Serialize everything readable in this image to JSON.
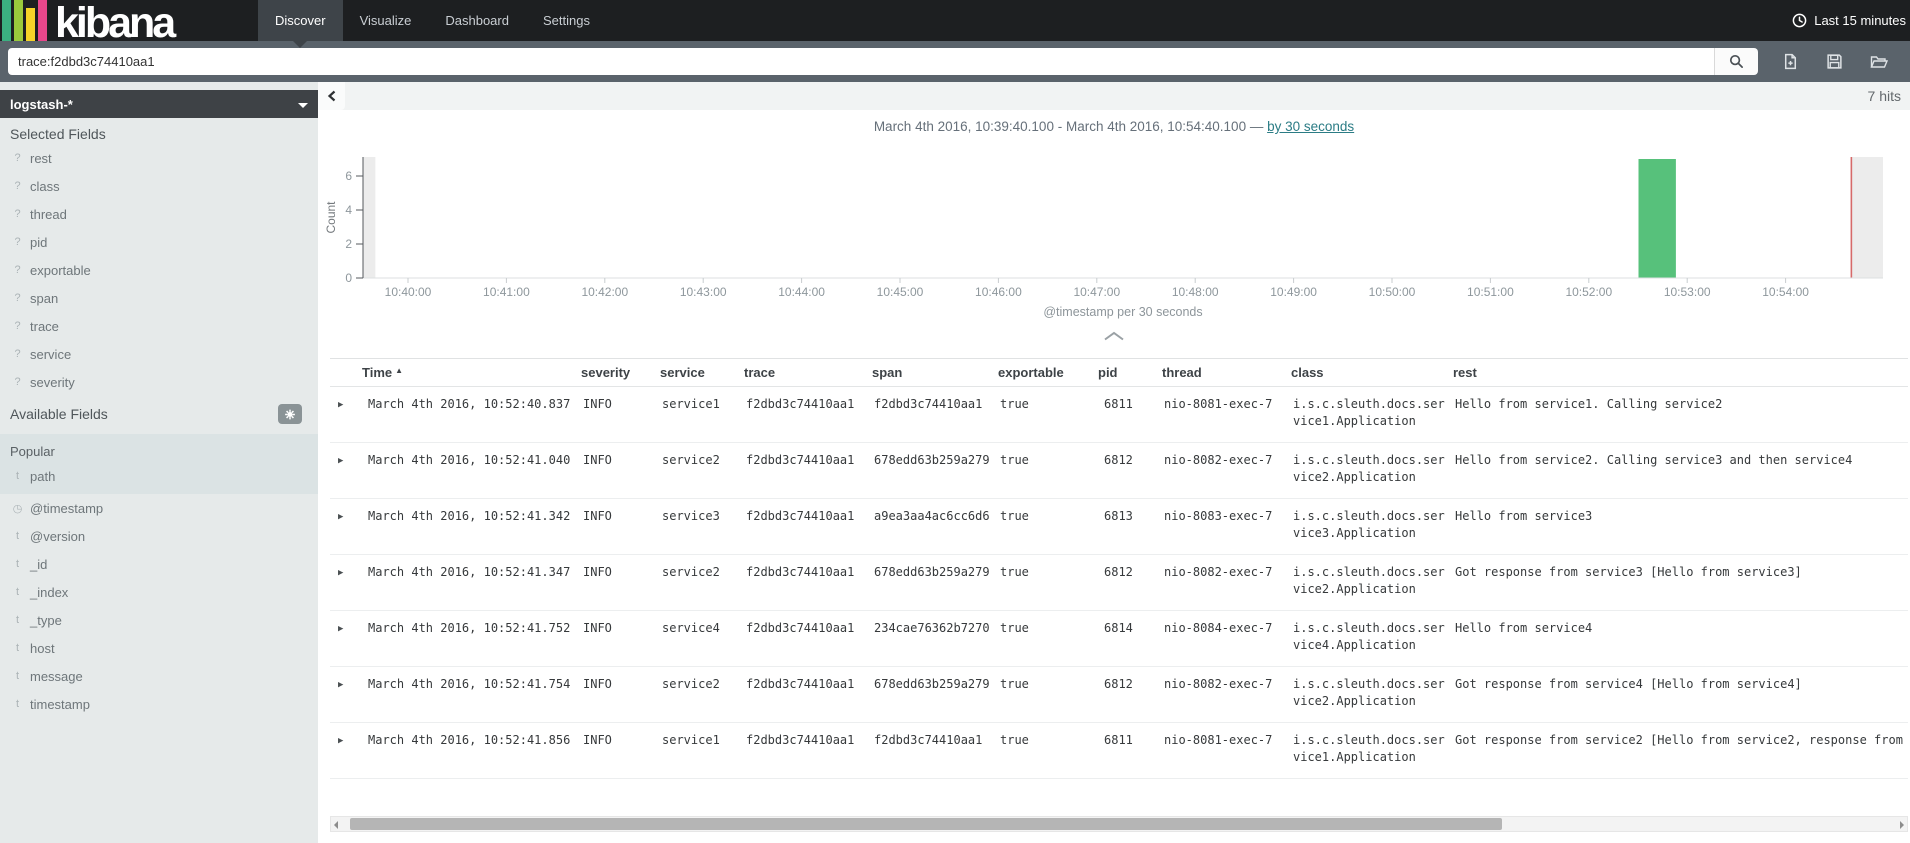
{
  "navbar": {
    "brand": "kibana",
    "nav_items": [
      {
        "label": "Discover",
        "active": true
      },
      {
        "label": "Visualize",
        "active": false
      },
      {
        "label": "Dashboard",
        "active": false
      },
      {
        "label": "Settings",
        "active": false
      }
    ],
    "time_filter": "Last 15 minutes"
  },
  "query_bar": {
    "query": "trace:f2dbd3c74410aa1"
  },
  "sidebar": {
    "index_pattern": "logstash-*",
    "selected_fields_title": "Selected Fields",
    "selected_fields": [
      {
        "type": "?",
        "name": "rest"
      },
      {
        "type": "?",
        "name": "class"
      },
      {
        "type": "?",
        "name": "thread"
      },
      {
        "type": "?",
        "name": "pid"
      },
      {
        "type": "?",
        "name": "exportable"
      },
      {
        "type": "?",
        "name": "span"
      },
      {
        "type": "?",
        "name": "trace"
      },
      {
        "type": "?",
        "name": "service"
      },
      {
        "type": "?",
        "name": "severity"
      }
    ],
    "available_fields_title": "Available Fields",
    "popular_title": "Popular",
    "popular_fields": [
      {
        "type": "t",
        "name": "path"
      }
    ],
    "available_fields": [
      {
        "type": "clock",
        "name": "@timestamp"
      },
      {
        "type": "t",
        "name": "@version"
      },
      {
        "type": "t",
        "name": "_id"
      },
      {
        "type": "t",
        "name": "_index"
      },
      {
        "type": "t",
        "name": "_type"
      },
      {
        "type": "t",
        "name": "host"
      },
      {
        "type": "t",
        "name": "message"
      },
      {
        "type": "t",
        "name": "timestamp"
      }
    ]
  },
  "results_header": {
    "hits": "7 hits",
    "time_range": "March 4th 2016, 10:39:40.100 - March 4th 2016, 10:54:40.100 —",
    "interval_link": "by 30 seconds"
  },
  "chart_data": {
    "type": "bar",
    "title": "",
    "xlabel": "@timestamp per 30 seconds",
    "ylabel": "Count",
    "y_ticks": [
      0,
      2,
      4,
      6
    ],
    "ylim": [
      0,
      7
    ],
    "x_tick_labels": [
      "10:40:00",
      "10:41:00",
      "10:42:00",
      "10:43:00",
      "10:44:00",
      "10:45:00",
      "10:46:00",
      "10:47:00",
      "10:48:00",
      "10:49:00",
      "10:50:00",
      "10:51:00",
      "10:52:00",
      "10:53:00",
      "10:54:00"
    ],
    "x_range": [
      "10:39:40.100",
      "10:54:40.100"
    ],
    "bucket_seconds": 30,
    "bars": [
      {
        "x_start": "10:52:30",
        "value": 7
      }
    ],
    "colors": {
      "bar": "#57c17b",
      "time_marker": "#d66a6a",
      "out_of_range_band": "#ececec",
      "link": "#2b7c85"
    }
  },
  "table": {
    "columns": [
      "Time",
      "severity",
      "service",
      "trace",
      "span",
      "exportable",
      "pid",
      "thread",
      "class",
      "rest"
    ],
    "sort": {
      "column": "Time",
      "direction": "asc"
    },
    "rows": [
      {
        "time": "March 4th 2016, 10:52:40.837",
        "severity": "INFO",
        "service": "service1",
        "trace": "f2dbd3c74410aa1",
        "span": "f2dbd3c74410aa1",
        "exportable": "true",
        "pid": "6811",
        "thread": "nio-8081-exec-7",
        "class": "i.s.c.sleuth.docs.service1.Application",
        "rest": "Hello from service1. Calling service2"
      },
      {
        "time": "March 4th 2016, 10:52:41.040",
        "severity": "INFO",
        "service": "service2",
        "trace": "f2dbd3c74410aa1",
        "span": "678edd63b259a279",
        "exportable": "true",
        "pid": "6812",
        "thread": "nio-8082-exec-7",
        "class": "i.s.c.sleuth.docs.service2.Application",
        "rest": "Hello from service2. Calling service3 and then service4"
      },
      {
        "time": "March 4th 2016, 10:52:41.342",
        "severity": "INFO",
        "service": "service3",
        "trace": "f2dbd3c74410aa1",
        "span": "a9ea3aa4ac6cc6d6",
        "exportable": "true",
        "pid": "6813",
        "thread": "nio-8083-exec-7",
        "class": "i.s.c.sleuth.docs.service3.Application",
        "rest": "Hello from service3"
      },
      {
        "time": "March 4th 2016, 10:52:41.347",
        "severity": "INFO",
        "service": "service2",
        "trace": "f2dbd3c74410aa1",
        "span": "678edd63b259a279",
        "exportable": "true",
        "pid": "6812",
        "thread": "nio-8082-exec-7",
        "class": "i.s.c.sleuth.docs.service2.Application",
        "rest": "Got response from service3 [Hello from service3]"
      },
      {
        "time": "March 4th 2016, 10:52:41.752",
        "severity": "INFO",
        "service": "service4",
        "trace": "f2dbd3c74410aa1",
        "span": "234cae76362b7270",
        "exportable": "true",
        "pid": "6814",
        "thread": "nio-8084-exec-7",
        "class": "i.s.c.sleuth.docs.service4.Application",
        "rest": "Hello from service4"
      },
      {
        "time": "March 4th 2016, 10:52:41.754",
        "severity": "INFO",
        "service": "service2",
        "trace": "f2dbd3c74410aa1",
        "span": "678edd63b259a279",
        "exportable": "true",
        "pid": "6812",
        "thread": "nio-8082-exec-7",
        "class": "i.s.c.sleuth.docs.service2.Application",
        "rest": "Got response from service4 [Hello from service4]"
      },
      {
        "time": "March 4th 2016, 10:52:41.856",
        "severity": "INFO",
        "service": "service1",
        "trace": "f2dbd3c74410aa1",
        "span": "f2dbd3c74410aa1",
        "exportable": "true",
        "pid": "6811",
        "thread": "nio-8081-exec-7",
        "class": "i.s.c.sleuth.docs.service1.Application",
        "rest": "Got response from service2 [Hello from service2, response from"
      }
    ]
  }
}
